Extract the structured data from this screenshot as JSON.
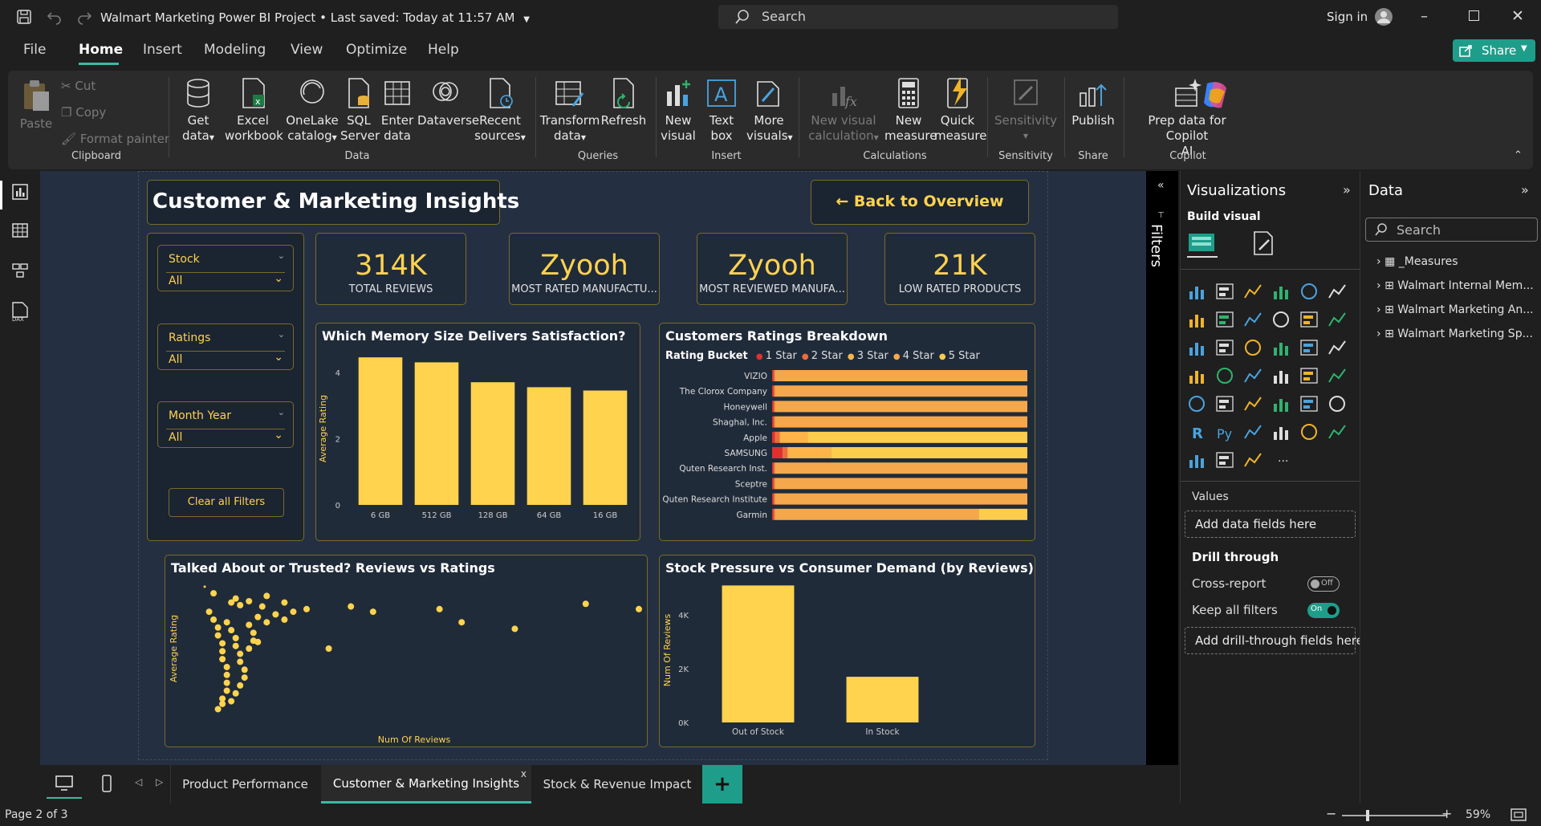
{
  "titlebar": {
    "title": "Walmart Marketing Power BI Project",
    "saved": "Last saved: Today at 11:57 AM",
    "separator": "•",
    "search_placeholder": "Search",
    "signin": "Sign in"
  },
  "menu": {
    "items": [
      "File",
      "Home",
      "Insert",
      "Modeling",
      "View",
      "Optimize",
      "Help"
    ],
    "share": "Share"
  },
  "ribbon": {
    "paste": "Paste",
    "cut": "Cut",
    "copy": "Copy",
    "format_painter": "Format painter",
    "clipboard": "Clipboard",
    "get_data": [
      "Get",
      "data"
    ],
    "excel": [
      "Excel",
      "workbook"
    ],
    "onelake": [
      "OneLake",
      "catalog"
    ],
    "sql": [
      "SQL",
      "Server"
    ],
    "enter": [
      "Enter",
      "data"
    ],
    "dataverse": "Dataverse",
    "recent": [
      "Recent",
      "sources"
    ],
    "data_group": "Data",
    "transform": [
      "Transform",
      "data"
    ],
    "refresh": "Refresh",
    "queries": "Queries",
    "new_visual": [
      "New",
      "visual"
    ],
    "text_box": [
      "Text",
      "box"
    ],
    "more_visuals": [
      "More",
      "visuals"
    ],
    "insert_group": "Insert",
    "new_calc": [
      "New visual",
      "calculation"
    ],
    "new_measure": [
      "New",
      "measure"
    ],
    "quick_measure": [
      "Quick",
      "measure"
    ],
    "calculations": "Calculations",
    "sensitivity": "Sensitivity",
    "sensitivity_group": "Sensitivity",
    "publish": "Publish",
    "share_group": "Share",
    "copilot": [
      "Prep data for Copilot",
      "AI"
    ],
    "copilot_group": "Copilot"
  },
  "report": {
    "title": "Customer & Marketing Insights",
    "back_button": "← Back to Overview",
    "slicers": [
      {
        "label": "Stock",
        "value": "All"
      },
      {
        "label": "Ratings",
        "value": "All"
      },
      {
        "label": "Month Year",
        "value": "All"
      }
    ],
    "clear_filters": "Clear all Filters",
    "kpis": [
      {
        "value": "314K",
        "label": "TOTAL REVIEWS"
      },
      {
        "value": "Zyooh",
        "label": "MOST RATED MANUFACTU..."
      },
      {
        "value": "Zyooh",
        "label": "MOST REVIEWED MANUFA..."
      },
      {
        "value": "21K",
        "label": "LOW RATED PRODUCTS"
      }
    ],
    "memory_chart": {
      "title": "Which Memory Size Delivers Satisfaction?",
      "ylabel": "Average Rating",
      "ticks": [
        "4",
        "2",
        "0"
      ]
    },
    "ratings_chart": {
      "title": "Customers Ratings Breakdown",
      "legend_title": "Rating Bucket",
      "legend": [
        "1 Star",
        "2 Star",
        "3 Star",
        "4 Star",
        "5 Star"
      ]
    },
    "scatter_chart": {
      "title": "Talked About or Trusted? Reviews vs Ratings",
      "xlabel": "Num Of Reviews",
      "ylabel": "Average Rating"
    },
    "stock_chart": {
      "title": "Stock Pressure vs Consumer Demand (by Reviews)",
      "ylabel": "Num Of Reviews",
      "ticks": [
        "4K",
        "2K",
        "0K"
      ]
    }
  },
  "tabs": {
    "items": [
      "Product Performance",
      "Customer & Marketing Insights",
      "Stock & Revenue Impact"
    ],
    "add": "+",
    "close": "x"
  },
  "status": {
    "page": "Page 2 of 3",
    "zoom": "59%",
    "minus": "−",
    "plus": "+"
  },
  "filters": {
    "label": "Filters"
  },
  "viz": {
    "title": "Visualizations",
    "build": "Build visual",
    "values": "Values",
    "add_data": "Add data fields here",
    "drill": "Drill through",
    "cross_report": "Cross-report",
    "cross_state": "Off",
    "keep_filters": "Keep all filters",
    "keep_state": "On",
    "add_drill": "Add drill-through fields here"
  },
  "data_pane": {
    "title": "Data",
    "search_placeholder": "Search",
    "items": [
      "_Measures",
      "Walmart Internal Mem...",
      "Walmart Marketing An...",
      "Walmart Marketing Sp..."
    ]
  },
  "colors": {
    "accent": "#ffd34e",
    "star1": "#e0312f",
    "star2": "#f06b3c",
    "star3": "#ffb44a",
    "star4": "#f5a84b",
    "star5": "#fccc4d",
    "teal": "#1e9e8a"
  },
  "chart_data": [
    {
      "type": "bar",
      "title": "Which Memory Size Delivers Satisfaction?",
      "categories": [
        "6 GB",
        "512 GB",
        "128 GB",
        "64 GB",
        "16 GB"
      ],
      "values": [
        4.45,
        4.3,
        3.7,
        3.55,
        3.45
      ],
      "ylabel": "Average Rating",
      "ylim": [
        0,
        4.6
      ]
    },
    {
      "type": "bar",
      "orientation": "horizontal-stacked",
      "title": "Customers Ratings Breakdown",
      "categories": [
        "VIZIO",
        "The Clorox Company",
        "Honeywell",
        "Shaghal, Inc.",
        "Apple",
        "SAMSUNG",
        "Quten Research Inst.",
        "Sceptre",
        "Quten Research Institute",
        "Garmin"
      ],
      "series": [
        {
          "name": "1 Star",
          "values": [
            0.5,
            0.5,
            0.5,
            0.5,
            1,
            4,
            0.5,
            0.5,
            0.5,
            0.5
          ]
        },
        {
          "name": "2 Star",
          "values": [
            0.5,
            0.5,
            0.5,
            0.5,
            2,
            2,
            0.5,
            0.5,
            0.5,
            0.5
          ]
        },
        {
          "name": "3 Star",
          "values": [
            0,
            0,
            0,
            0,
            11,
            17,
            0,
            0,
            0,
            0
          ]
        },
        {
          "name": "4 Star",
          "values": [
            99,
            99,
            99,
            99,
            0,
            0,
            99,
            99,
            99,
            80
          ]
        },
        {
          "name": "5 Star",
          "values": [
            0,
            0,
            0,
            0,
            86,
            77,
            0,
            0,
            0,
            19
          ]
        }
      ],
      "xlim": [
        0,
        100
      ]
    },
    {
      "type": "scatter",
      "title": "Talked About or Trusted? Reviews vs Ratings",
      "xlabel": "Num Of Reviews",
      "ylabel": "Average Rating",
      "xlim": [
        0,
        100
      ],
      "ylim": [
        0,
        100
      ],
      "points": [
        [
          2,
          97
        ],
        [
          8,
          85
        ],
        [
          10,
          83
        ],
        [
          12,
          86
        ],
        [
          15,
          82
        ],
        [
          20,
          85
        ],
        [
          25,
          80
        ],
        [
          35,
          82
        ],
        [
          40,
          78
        ],
        [
          55,
          80
        ],
        [
          60,
          70
        ],
        [
          72,
          65
        ],
        [
          88,
          84
        ],
        [
          100,
          80
        ],
        [
          14,
          55
        ],
        [
          30,
          50
        ],
        [
          3,
          78
        ],
        [
          4,
          72
        ],
        [
          5,
          66
        ],
        [
          5,
          60
        ],
        [
          6,
          54
        ],
        [
          6,
          48
        ],
        [
          6,
          42
        ],
        [
          7,
          36
        ],
        [
          7,
          30
        ],
        [
          7,
          24
        ],
        [
          7,
          18
        ],
        [
          6,
          12
        ],
        [
          6,
          8
        ],
        [
          5,
          4
        ],
        [
          7,
          70
        ],
        [
          8,
          64
        ],
        [
          9,
          58
        ],
        [
          9,
          52
        ],
        [
          10,
          46
        ],
        [
          10,
          40
        ],
        [
          11,
          34
        ],
        [
          11,
          28
        ],
        [
          10,
          22
        ],
        [
          9,
          16
        ],
        [
          8,
          10
        ],
        [
          12,
          68
        ],
        [
          13,
          62
        ],
        [
          13,
          56
        ],
        [
          12,
          50
        ],
        [
          14,
          74
        ],
        [
          16,
          70
        ],
        [
          18,
          76
        ],
        [
          20,
          72
        ],
        [
          22,
          78
        ],
        [
          9,
          88
        ],
        [
          16,
          90
        ],
        [
          4,
          92
        ]
      ]
    },
    {
      "type": "bar",
      "title": "Stock Pressure vs Consumer Demand (by Reviews)",
      "categories": [
        "Out of Stock",
        "In Stock"
      ],
      "values": [
        5100,
        1700
      ],
      "ylabel": "Num Of Reviews",
      "ylim": [
        0,
        5200
      ]
    }
  ]
}
